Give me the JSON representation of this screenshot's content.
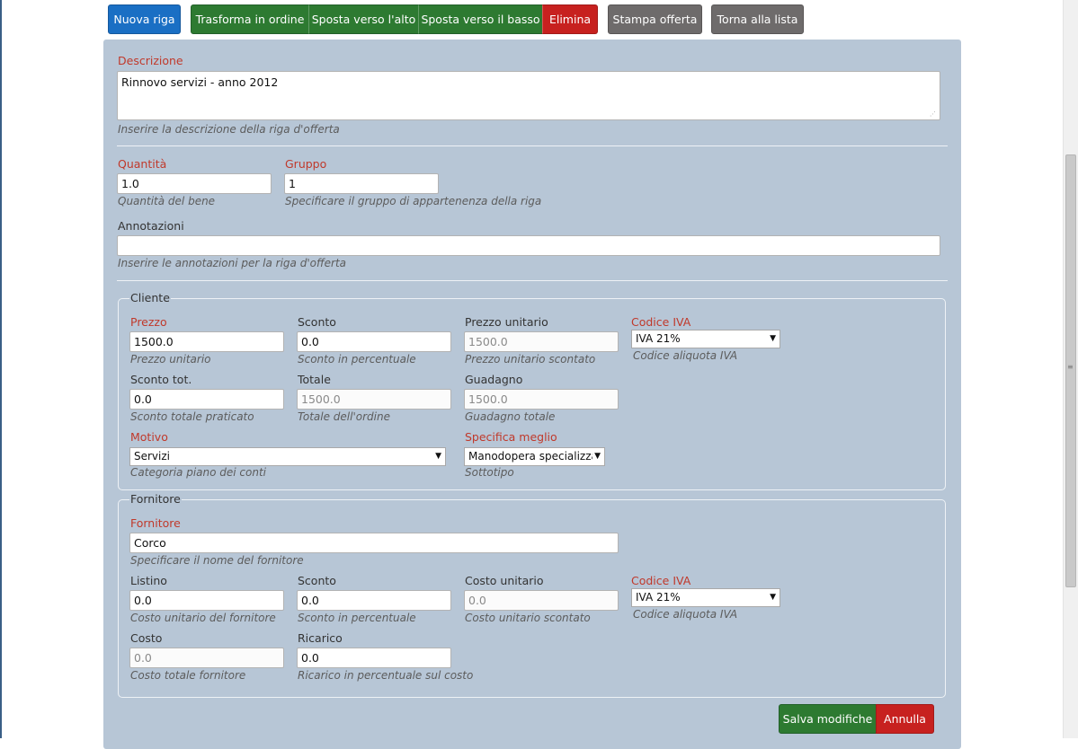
{
  "toolbar": {
    "new_row": "Nuova riga",
    "to_order": "Trasforma in ordine",
    "move_up": "Sposta verso l'alto",
    "move_down": "Sposta verso il basso",
    "delete": "Elimina",
    "print_offer": "Stampa offerta",
    "back_to_list": "Torna alla lista"
  },
  "description": {
    "label": "Descrizione",
    "value": "Rinnovo servizi - anno 2012",
    "hint": "Inserire la descrizione della riga d'offerta"
  },
  "quantity": {
    "label": "Quantità",
    "value": "1.0",
    "hint": "Quantità del bene"
  },
  "group": {
    "label": "Gruppo",
    "value": "1",
    "hint": "Specificare il gruppo di appartenenza della riga"
  },
  "notes": {
    "label": "Annotazioni",
    "value": "",
    "hint": "Inserire le annotazioni per la riga d'offerta"
  },
  "client": {
    "legend": "Cliente",
    "price": {
      "label": "Prezzo",
      "value": "1500.0",
      "hint": "Prezzo unitario"
    },
    "discount": {
      "label": "Sconto",
      "value": "0.0",
      "hint": "Sconto in percentuale"
    },
    "unit_price": {
      "label": "Prezzo unitario",
      "value": "1500.0",
      "hint": "Prezzo unitario scontato"
    },
    "vat": {
      "label": "Codice IVA",
      "value": "IVA 21%",
      "hint": "Codice aliquota IVA"
    },
    "total_discount": {
      "label": "Sconto tot.",
      "value": "0.0",
      "hint": "Sconto totale praticato"
    },
    "total": {
      "label": "Totale",
      "value": "1500.0",
      "hint": "Totale dell'ordine"
    },
    "profit": {
      "label": "Guadagno",
      "value": "1500.0",
      "hint": "Guadagno totale"
    },
    "reason": {
      "label": "Motivo",
      "value": "Servizi",
      "hint": "Categoria piano dei conti"
    },
    "detail": {
      "label": "Specifica meglio",
      "value": "Manodopera specializza",
      "hint": "Sottotipo"
    }
  },
  "supplier": {
    "legend": "Fornitore",
    "name": {
      "label": "Fornitore",
      "value": "Corco",
      "hint": "Specificare il nome del fornitore"
    },
    "list_price": {
      "label": "Listino",
      "value": "0.0",
      "hint": "Costo unitario del fornitore"
    },
    "discount": {
      "label": "Sconto",
      "value": "0.0",
      "hint": "Sconto in percentuale"
    },
    "unit_cost": {
      "label": "Costo unitario",
      "value": "0.0",
      "hint": "Costo unitario scontato"
    },
    "vat": {
      "label": "Codice IVA",
      "value": "IVA 21%",
      "hint": "Codice aliquota IVA"
    },
    "cost": {
      "label": "Costo",
      "value": "0.0",
      "hint": "Costo totale fornitore"
    },
    "markup": {
      "label": "Ricarico",
      "value": "0.0",
      "hint": "Ricarico in percentuale sul costo"
    }
  },
  "actions": {
    "save": "Salva modifiche",
    "cancel": "Annulla"
  },
  "icons": {
    "dropdown": "caret-down-icon",
    "resize": "resize-grip-icon"
  },
  "colors": {
    "primary": "#1a6fc4",
    "success": "#2d7a31",
    "danger": "#c7211f",
    "neutral": "#6e6b6b",
    "panel": "#b7c6d6",
    "required_label": "#c0392b"
  }
}
